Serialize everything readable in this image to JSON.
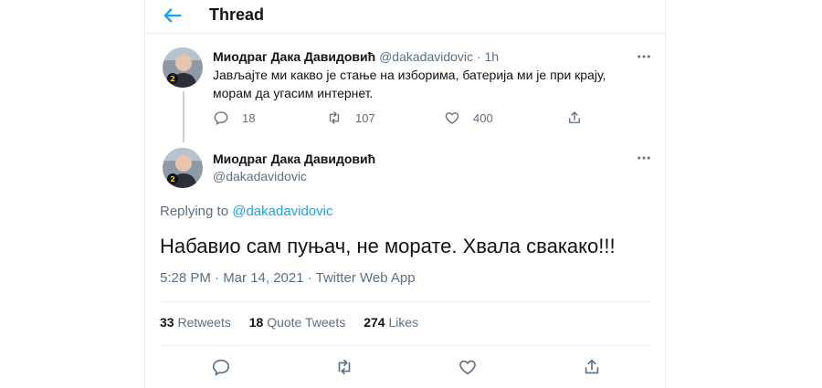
{
  "header": {
    "title": "Thread"
  },
  "parent_tweet": {
    "name": "Миодраг Дака Давидовић",
    "handle": "@dakadavidovic",
    "time": "1h",
    "text_line1": "Јављајте ми какво је стање на изборима, батерија ми је при крају,",
    "text_line2": "морам да угасим интернет.",
    "replies": "18",
    "retweets": "107",
    "likes": "400"
  },
  "main_tweet": {
    "name": "Миодраг Дака Давидовић",
    "handle": "@dakadavidovic",
    "replying_prefix": "Replying to",
    "replying_handle": "@dakadavidovic",
    "text": "Набавио сам пуњач, не морате. Хвала свакако!!!",
    "timestamp": "5:28 PM · Mar 14, 2021 · Twitter Web App",
    "stats": {
      "retweets_count": "33",
      "retweets_label": "Retweets",
      "quotes_count": "18",
      "quotes_label": "Quote Tweets",
      "likes_count": "274",
      "likes_label": "Likes"
    }
  },
  "colors": {
    "accent": "#1da1f2",
    "muted": "#5b7083",
    "border": "#ebeef0"
  }
}
